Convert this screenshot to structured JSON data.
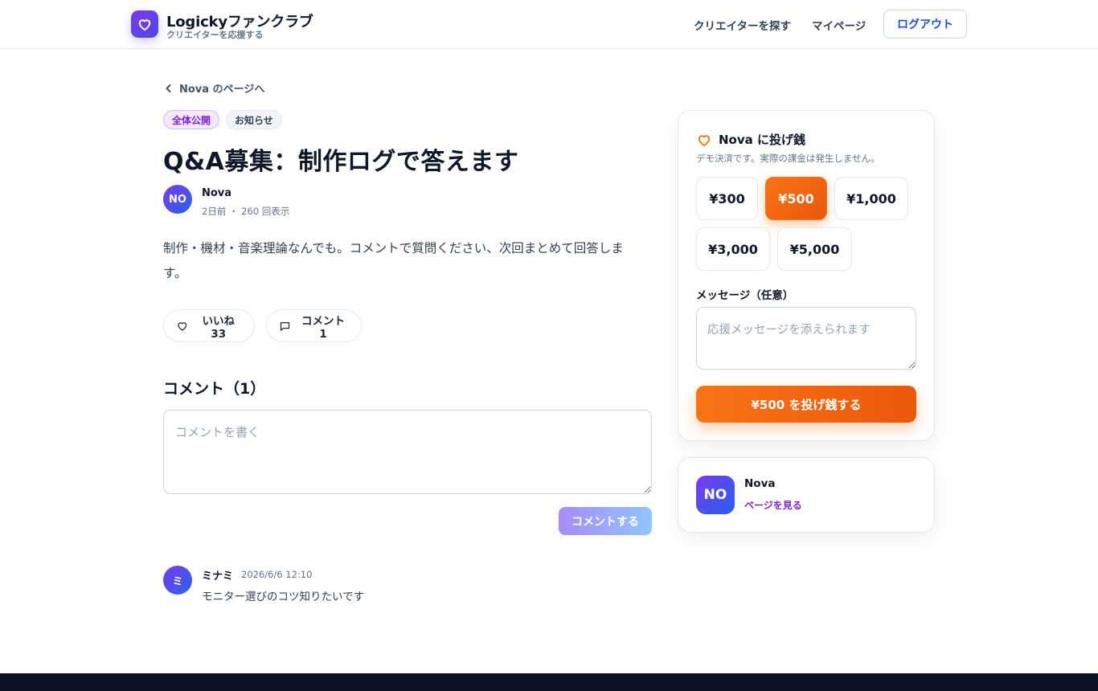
{
  "header": {
    "brand_title": "Logickyファンクラブ",
    "brand_subtitle": "クリエイターを応援する",
    "nav": [
      "クリエイターを探す",
      "マイページ"
    ],
    "logout_label": "ログアウト"
  },
  "post": {
    "back_link": "Nova のページへ",
    "tags": [
      "全体公開",
      "お知らせ"
    ],
    "title": "Q&A募集：制作ログで答えます",
    "author": {
      "initials": "NO",
      "name": "Nova",
      "meta": "2日前 ・ 260 回表示"
    },
    "body": "制作・機材・音楽理論なんでも。コメントで質問ください、次回まとめて回答します。",
    "like_label": "いいね 33",
    "comment_label": "コメント 1"
  },
  "comments": {
    "section_title": "コメント（1）",
    "input_placeholder": "コメントを書く",
    "submit_label": "コメントする",
    "items": [
      {
        "initial": "ミ",
        "author": "ミナミ",
        "time": "2026/6/6 12:10",
        "text": "モニター選びのコツ知りたいです"
      }
    ]
  },
  "tip": {
    "heading": "Nova に投げ銭",
    "note": "デモ決済です。実際の課金は発生しません。",
    "amounts": [
      "¥300",
      "¥500",
      "¥1,000",
      "¥3,000",
      "¥5,000"
    ],
    "selected_amount": "¥500",
    "message_label": "メッセージ（任意）",
    "message_placeholder": "応援メッセージを添えられます",
    "submit_label": "¥500 を投げ銭する",
    "accent_color": "#f97316"
  },
  "creator_card": {
    "initials": "NO",
    "name": "Nova",
    "link_label": "ページを見る"
  },
  "colors": {
    "brand_purple": "#7c3aed",
    "brand_indigo": "#4f46e5",
    "footer": "#0b1224"
  }
}
